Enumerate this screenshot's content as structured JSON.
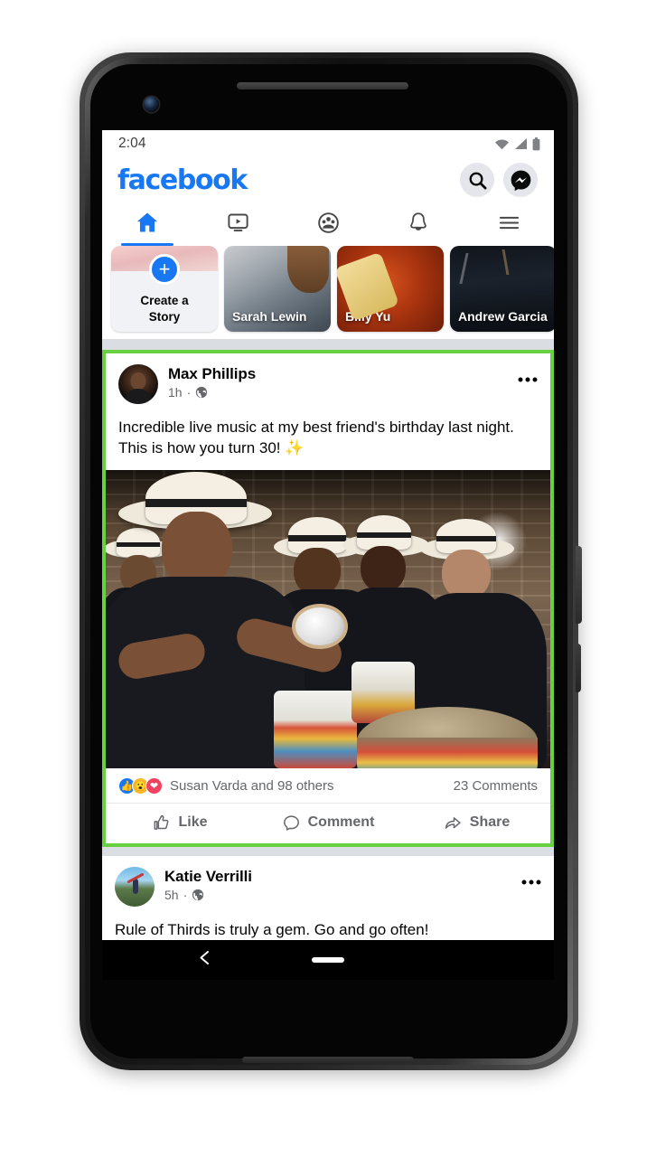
{
  "device": {
    "model_shape": "android-phone",
    "front_camera": "camera-icon",
    "earpiece": "speaker-grille"
  },
  "status_bar": {
    "time": "2:04",
    "icons": [
      "wifi-icon",
      "cellular-signal-icon",
      "battery-icon"
    ]
  },
  "header": {
    "logo_text": "facebook",
    "brand_color": "#1877F2",
    "actions": [
      {
        "name": "search-button",
        "icon": "search-icon"
      },
      {
        "name": "messenger-button",
        "icon": "messenger-icon"
      }
    ]
  },
  "tabs": [
    {
      "name": "tab-home",
      "icon": "home-icon",
      "active": true
    },
    {
      "name": "tab-watch",
      "icon": "video-play-icon",
      "active": false
    },
    {
      "name": "tab-groups",
      "icon": "groups-icon",
      "active": false
    },
    {
      "name": "tab-notifications",
      "icon": "bell-icon",
      "active": false
    },
    {
      "name": "tab-menu",
      "icon": "hamburger-menu-icon",
      "active": false
    }
  ],
  "stories": [
    {
      "type": "create",
      "label_line1": "Create a",
      "label_line2": "Story",
      "icon": "plus-icon"
    },
    {
      "type": "photo",
      "label": "Sarah Lewin"
    },
    {
      "type": "photo",
      "label": "Billy Yu"
    },
    {
      "type": "photo",
      "label": "Andrew Garcia"
    }
  ],
  "posts": [
    {
      "id": "post-max-phillips",
      "highlighted": true,
      "highlight_color": "#69D044",
      "author": "Max Phillips",
      "time": "1h",
      "privacy_icon": "globe-icon",
      "separator": "·",
      "more_icon": "ellipsis-icon",
      "text": "Incredible live music at my best friend's birthday last night. This is how you turn 30! ✨",
      "photo_alt": "samba band drummers in white hats playing surdo drums",
      "reactions": {
        "types": [
          "like-reaction-icon",
          "wow-reaction-icon",
          "love-reaction-icon"
        ],
        "summary": "Susan Varda and 98 others",
        "comments": "23 Comments"
      },
      "actions": [
        {
          "name": "like-button",
          "label": "Like",
          "icon": "thumbs-up-icon"
        },
        {
          "name": "comment-button",
          "label": "Comment",
          "icon": "comment-bubble-icon"
        },
        {
          "name": "share-button",
          "label": "Share",
          "icon": "share-arrow-icon"
        }
      ]
    },
    {
      "id": "post-katie-verrilli",
      "highlighted": false,
      "author": "Katie Verrilli",
      "time": "5h",
      "privacy_icon": "globe-icon",
      "separator": "·",
      "more_icon": "ellipsis-icon",
      "text": "Rule of Thirds is truly a gem. Go and go often!"
    }
  ],
  "system_nav": {
    "back": "back-chevron-icon",
    "home_pill": "home-gesture-pill"
  }
}
